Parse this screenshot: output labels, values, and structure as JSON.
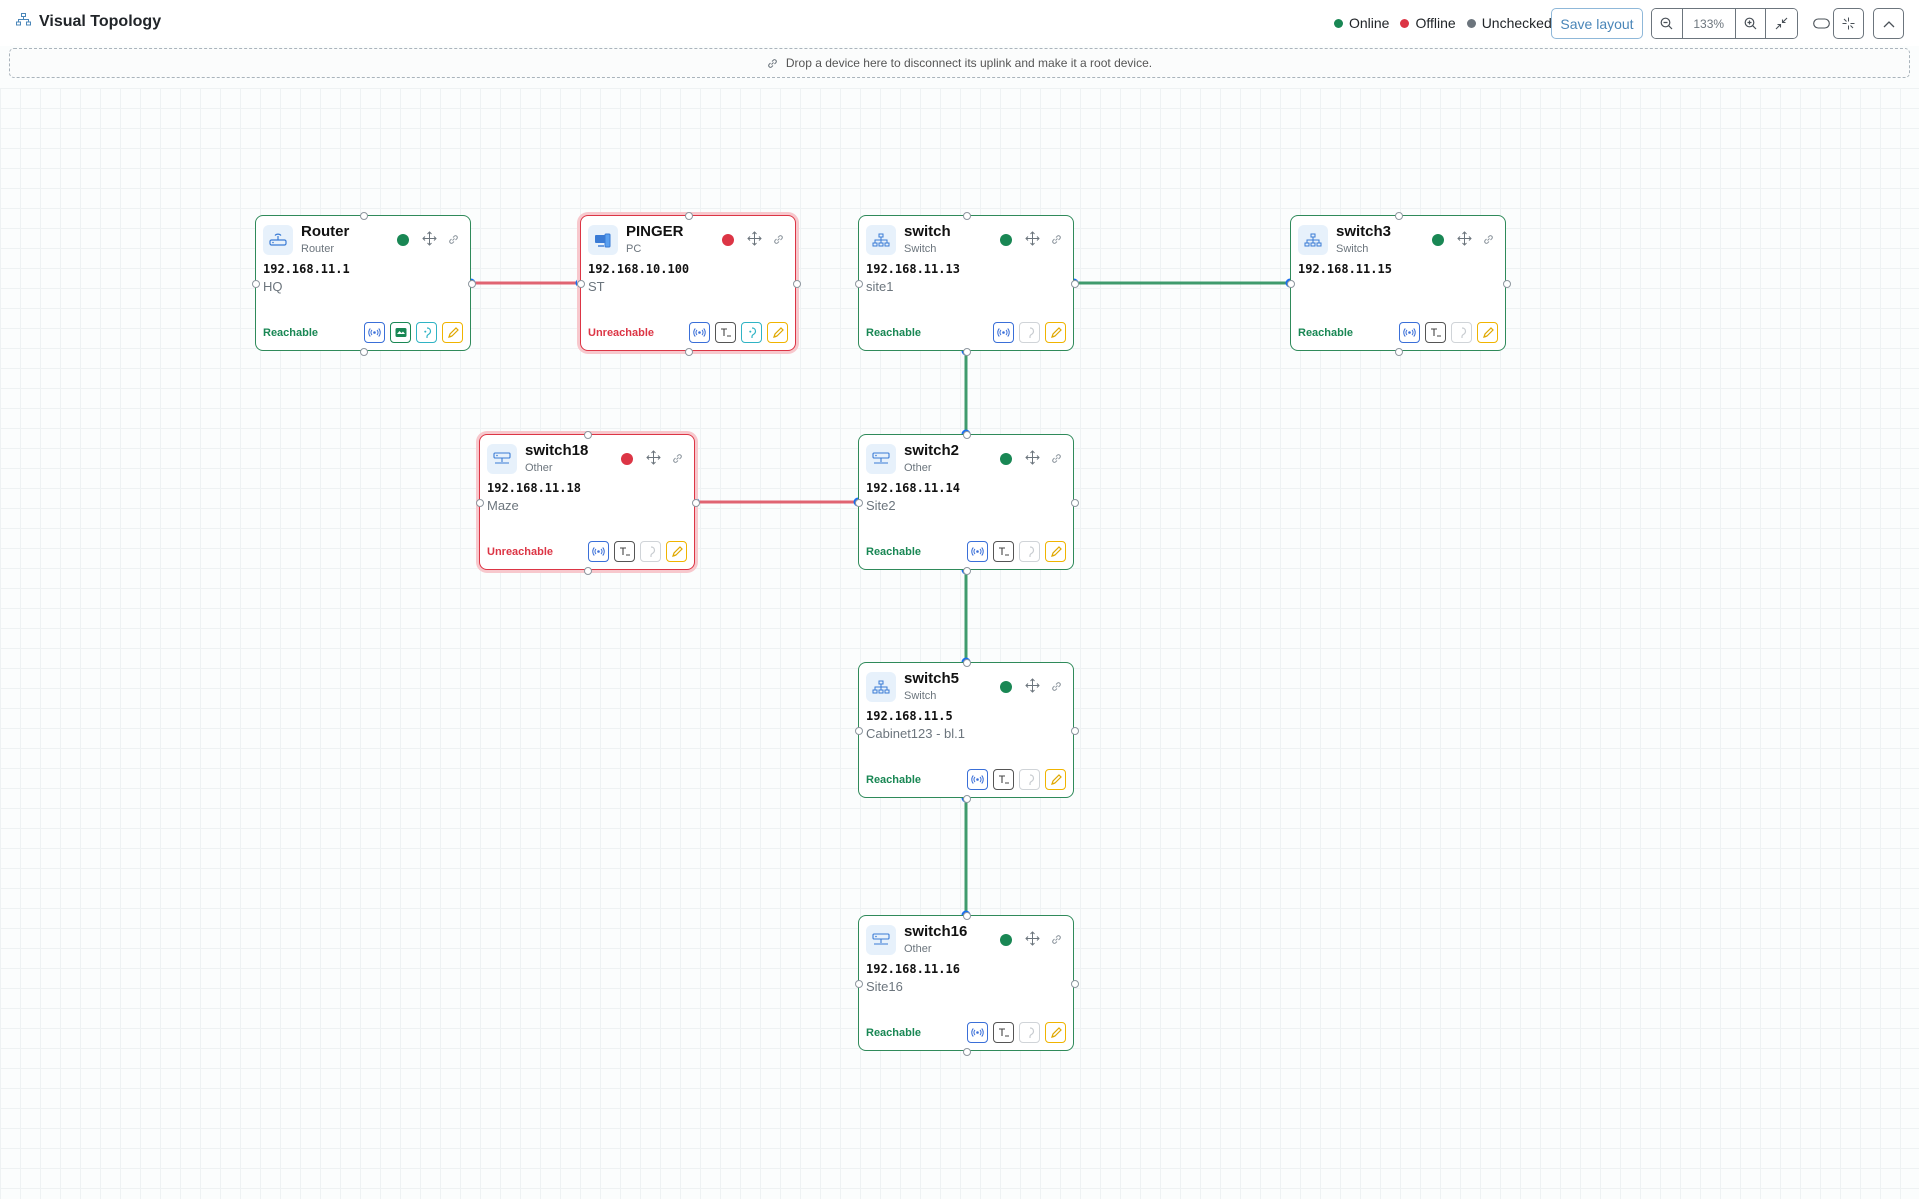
{
  "header": {
    "title": "Visual Topology",
    "legend": {
      "online": "Online",
      "offline": "Offline",
      "unchecked": "Unchecked"
    },
    "save_label": "Save layout",
    "zoom": "133%"
  },
  "dropzone": {
    "text": "Drop a device here to disconnect its uplink and make it a root device."
  },
  "colors": {
    "online": "#198754",
    "offline": "#dc3545",
    "unchecked": "#6c757d",
    "link_ok": "#3f9b6d",
    "link_bad": "#e06472",
    "port": "#1a6ff0"
  },
  "nodes": [
    {
      "id": "router",
      "name": "Router",
      "type": "Router",
      "ip": "192.168.11.1",
      "location": "HQ",
      "status": "online",
      "reach": "Reachable",
      "icon": "router-icon",
      "actions": [
        "ping",
        "web",
        "ssh",
        "edit"
      ]
    },
    {
      "id": "pinger",
      "name": "PINGER",
      "type": "PC",
      "ip": "192.168.10.100",
      "location": "ST",
      "status": "offline",
      "reach": "Unreachable",
      "icon": "pc-icon",
      "actions": [
        "ping",
        "terminal",
        "ssh",
        "edit"
      ]
    },
    {
      "id": "switch",
      "name": "switch",
      "type": "Switch",
      "ip": "192.168.11.13",
      "location": "site1",
      "status": "online",
      "reach": "Reachable",
      "icon": "switch-icon",
      "actions": [
        "ping",
        "ssh-disabled",
        "edit"
      ]
    },
    {
      "id": "switch3",
      "name": "switch3",
      "type": "Switch",
      "ip": "192.168.11.15",
      "location": "",
      "status": "online",
      "reach": "Reachable",
      "icon": "switch-icon",
      "actions": [
        "ping",
        "terminal",
        "ssh-disabled",
        "edit"
      ]
    },
    {
      "id": "switch18",
      "name": "switch18",
      "type": "Other",
      "ip": "192.168.11.18",
      "location": "Maze",
      "status": "offline",
      "reach": "Unreachable",
      "icon": "server-icon",
      "actions": [
        "ping",
        "terminal",
        "ssh-disabled",
        "edit"
      ]
    },
    {
      "id": "switch2",
      "name": "switch2",
      "type": "Other",
      "ip": "192.168.11.14",
      "location": "Site2",
      "status": "online",
      "reach": "Reachable",
      "icon": "server-icon",
      "actions": [
        "ping",
        "terminal",
        "ssh-disabled",
        "edit"
      ]
    },
    {
      "id": "switch5",
      "name": "switch5",
      "type": "Switch",
      "ip": "192.168.11.5",
      "location": "Cabinet123 - bl.1",
      "status": "online",
      "reach": "Reachable",
      "icon": "switch-icon",
      "actions": [
        "ping",
        "terminal",
        "ssh-disabled",
        "edit"
      ]
    },
    {
      "id": "switch16",
      "name": "switch16",
      "type": "Other",
      "ip": "192.168.11.16",
      "location": "Site16",
      "status": "online",
      "reach": "Reachable",
      "icon": "server-icon",
      "actions": [
        "ping",
        "terminal",
        "ssh-disabled",
        "edit"
      ]
    }
  ],
  "links": [
    {
      "from": "router",
      "to": "pinger",
      "state": "down"
    },
    {
      "from": "switch",
      "to": "switch3",
      "state": "up"
    },
    {
      "from": "switch",
      "to": "switch2",
      "state": "up"
    },
    {
      "from": "switch18",
      "to": "switch2",
      "state": "down"
    },
    {
      "from": "switch2",
      "to": "switch5",
      "state": "up"
    },
    {
      "from": "switch5",
      "to": "switch16",
      "state": "up"
    }
  ]
}
